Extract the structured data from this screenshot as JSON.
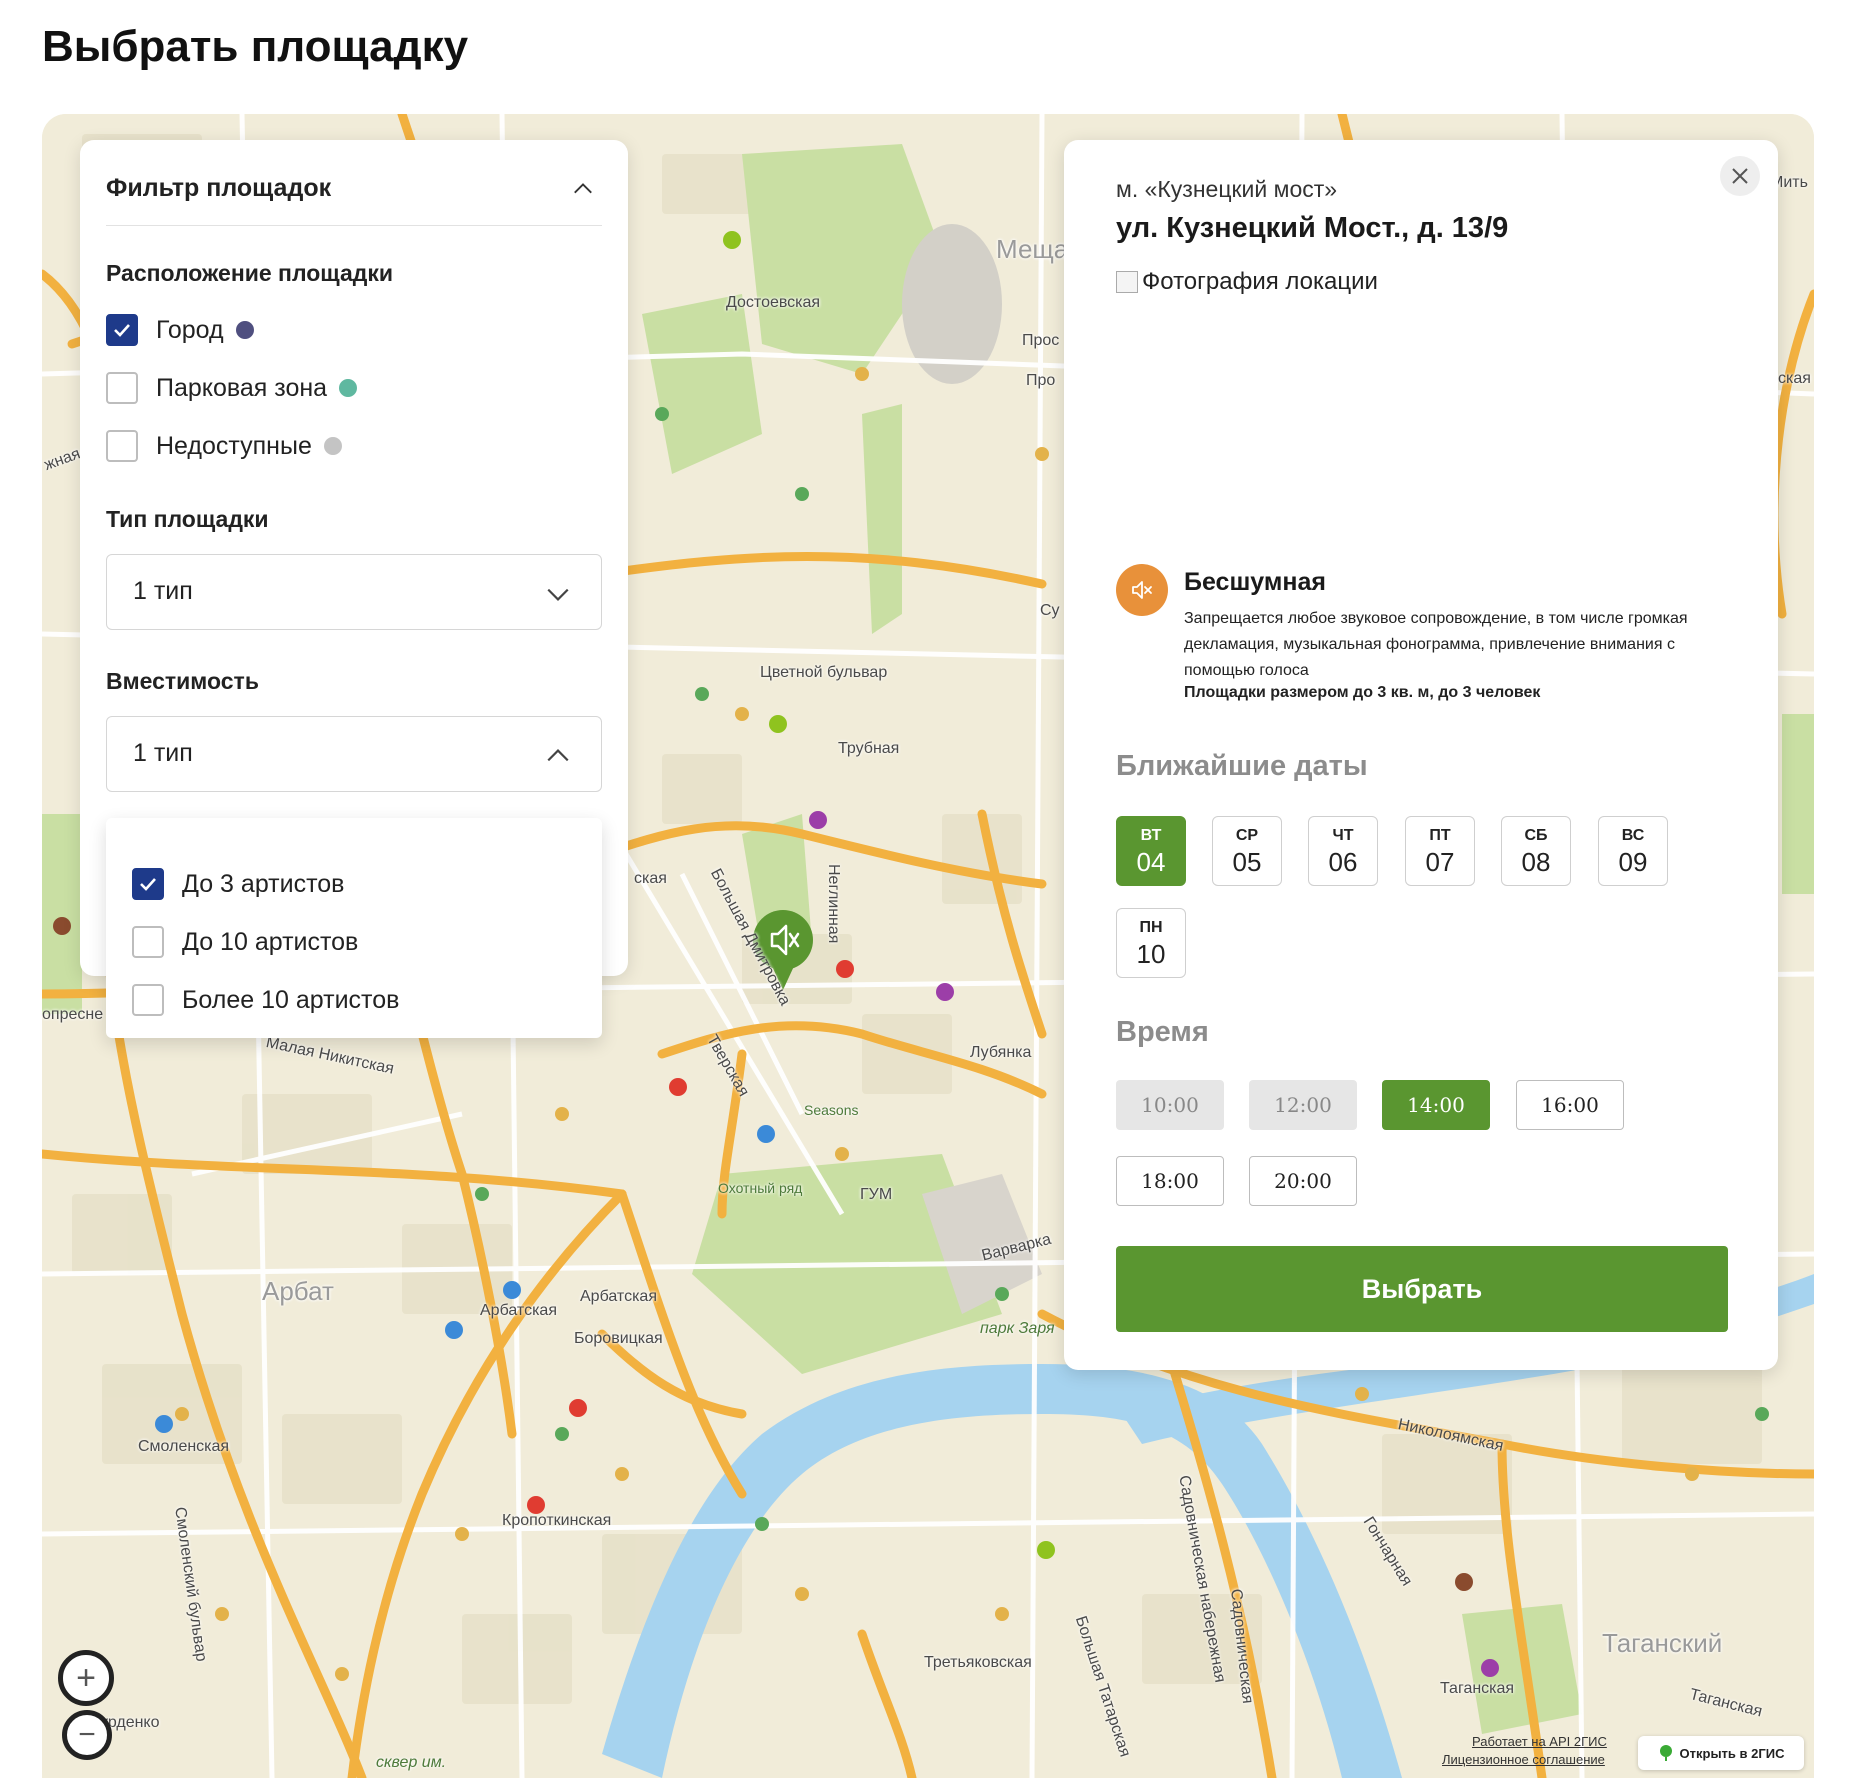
{
  "page": {
    "title": "Выбрать площадку"
  },
  "map": {
    "labels": [
      {
        "id": "dostoevskaya",
        "text": "Достоевская"
      },
      {
        "id": "meshchanskiy",
        "text": "Меща"
      },
      {
        "id": "prosp1",
        "text": "Прос"
      },
      {
        "id": "prosp2",
        "text": "Про"
      },
      {
        "id": "tsvetnoy",
        "text": "Цветной бульвар"
      },
      {
        "id": "trubnaya",
        "text": "Трубная"
      },
      {
        "id": "neglinnaya",
        "text": "Неглинная"
      },
      {
        "id": "bdmitrovka",
        "text": "Большая Дмитровка"
      },
      {
        "id": "tverskaya",
        "text": "Тверская"
      },
      {
        "id": "lubyanka",
        "text": "Лубянка"
      },
      {
        "id": "seasons",
        "text": "Seasons"
      },
      {
        "id": "okhotny",
        "text": "Охотный ряд"
      },
      {
        "id": "gum",
        "text": "ГУМ"
      },
      {
        "id": "varvarka",
        "text": "Варварка"
      },
      {
        "id": "park",
        "text": "парк Заря"
      },
      {
        "id": "malnikit",
        "text": "Малая Никитская"
      },
      {
        "id": "arbat",
        "text": "Арбат"
      },
      {
        "id": "arbatskaya1",
        "text": "Арбатская"
      },
      {
        "id": "arbatskaya2",
        "text": "Арбатская"
      },
      {
        "id": "borovitskaya",
        "text": "Боровицкая"
      },
      {
        "id": "smolenskaya",
        "text": "Смоленская"
      },
      {
        "id": "kropotkinskaya",
        "text": "Кропоткинская"
      },
      {
        "id": "smolbulvar",
        "text": "Смоленский бульвар"
      },
      {
        "id": "nikoloyamskaya",
        "text": "Николоямская"
      },
      {
        "id": "goncharnaya",
        "text": "Гончарная"
      },
      {
        "id": "taganskiy",
        "text": "Таганский"
      },
      {
        "id": "taganskaya1",
        "text": "Таганская"
      },
      {
        "id": "taganskaya2",
        "text": "Таганская"
      },
      {
        "id": "tretyakovskaya",
        "text": "Третьяковская"
      },
      {
        "id": "btatarskaya",
        "text": "Большая Татарская"
      },
      {
        "id": "sadnab",
        "text": "Садовническая набережная"
      },
      {
        "id": "sadovnicheskaya",
        "text": "Садовническая"
      },
      {
        "id": "kaya",
        "text": "ская"
      },
      {
        "id": "kaya2",
        "text": "ская"
      },
      {
        "id": "presne",
        "text": "опресне"
      },
      {
        "id": "rdenko",
        "text": "урденко"
      },
      {
        "id": "skver",
        "text": "сквер им."
      },
      {
        "id": "mit",
        "text": "Мить"
      },
      {
        "id": "su",
        "text": "Су"
      },
      {
        "id": "zhnaya",
        "text": "жная"
      }
    ],
    "attribution": {
      "api": "Работает на API 2ГИС",
      "license": "Лицензионное соглашение",
      "open_button": "Открыть в 2ГИС"
    },
    "zoom": {
      "in_symbol": "+",
      "out_symbol": "−"
    },
    "colors": {
      "main_road": "#f2b140",
      "water": "#a6d3ef",
      "park": "#c9dfa3",
      "land": "#f1ecd9",
      "marker": "#5a9630"
    }
  },
  "filter": {
    "title": "Фильтр площадок",
    "location": {
      "title": "Расположение площадки",
      "options": [
        {
          "label": "Город",
          "checked": true,
          "dot_color": "#4f4f7f"
        },
        {
          "label": "Парковая зона",
          "checked": false,
          "dot_color": "#5fb8a0"
        },
        {
          "label": "Недоступные",
          "checked": false,
          "dot_color": "#c4c4c4"
        }
      ]
    },
    "type": {
      "title": "Тип площадки",
      "value": "1 тип"
    },
    "capacity": {
      "title": "Вместимость",
      "value": "1 тип",
      "options": [
        {
          "label": "До 3 артистов",
          "checked": true
        },
        {
          "label": "До 10 артистов",
          "checked": false
        },
        {
          "label": "Более 10 артистов",
          "checked": false
        }
      ]
    }
  },
  "detail": {
    "metro": "м. «Кузнецкий мост»",
    "address": "ул. Кузнецкий Мост., д. 13/9",
    "photo_alt": "Фотография локации",
    "mode": {
      "title": "Бесшумная",
      "description": "Запрещается любое звуковое сопровождение, в том числе громкая декламация, музыкальная фонограмма, привлечение внимания с помощью голоса",
      "note": "Площадки размером до 3 кв. м, до 3 человек"
    },
    "dates_title": "Ближайшие даты",
    "dates": [
      {
        "weekday": "ВТ",
        "day": "04",
        "active": true
      },
      {
        "weekday": "СР",
        "day": "05",
        "active": false
      },
      {
        "weekday": "ЧТ",
        "day": "06",
        "active": false
      },
      {
        "weekday": "ПТ",
        "day": "07",
        "active": false
      },
      {
        "weekday": "СБ",
        "day": "08",
        "active": false
      },
      {
        "weekday": "ВС",
        "day": "09",
        "active": false
      },
      {
        "weekday": "ПН",
        "day": "10",
        "active": false
      }
    ],
    "time_title": "Время",
    "times": [
      {
        "label": "10:00",
        "state": "disabled"
      },
      {
        "label": "12:00",
        "state": "disabled"
      },
      {
        "label": "14:00",
        "state": "active"
      },
      {
        "label": "16:00",
        "state": "default"
      },
      {
        "label": "18:00",
        "state": "default"
      },
      {
        "label": "20:00",
        "state": "default"
      }
    ],
    "choose_button": "Выбрать",
    "accent_color": "#5a9630",
    "mode_icon_color": "#e8913a"
  }
}
